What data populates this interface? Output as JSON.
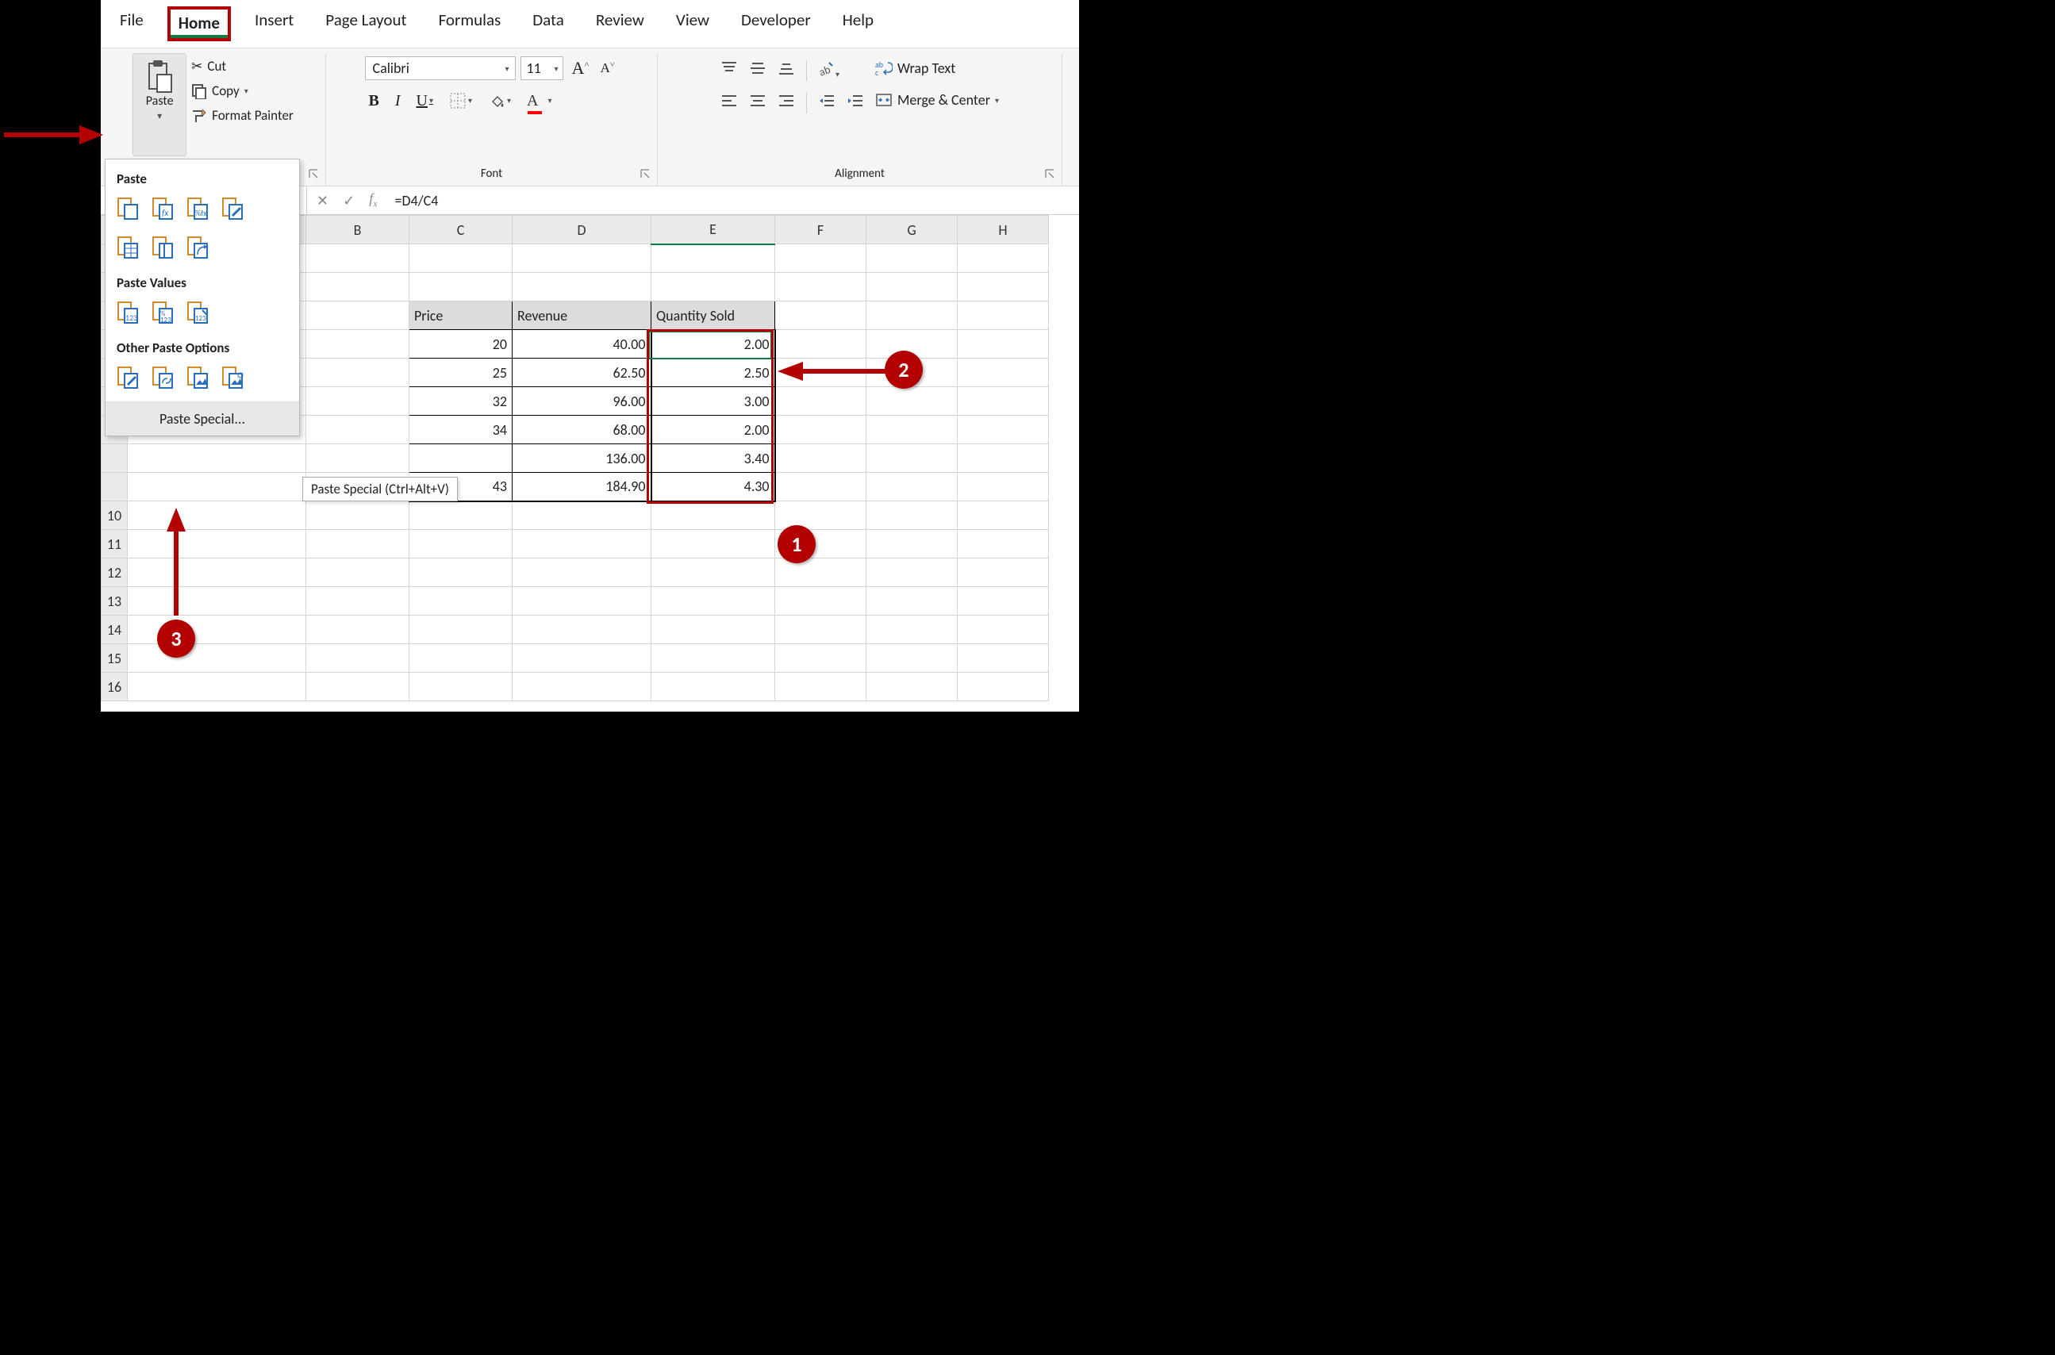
{
  "tabs": {
    "file": "File",
    "home": "Home",
    "insert": "Insert",
    "pagelayout": "Page Layout",
    "formulas": "Formulas",
    "data": "Data",
    "review": "Review",
    "view": "View",
    "developer": "Developer",
    "help": "Help"
  },
  "clipboard": {
    "paste": "Paste",
    "cut": "Cut",
    "copy": "Copy",
    "format_painter": "Format Painter"
  },
  "font": {
    "name": "Calibri",
    "size": "11",
    "group_label": "Font"
  },
  "alignment": {
    "wrap": "Wrap Text",
    "merge": "Merge & Center",
    "group_label": "Alignment"
  },
  "formula_bar": {
    "content": "=D4/C4"
  },
  "columns": {
    "b": "B",
    "c": "C",
    "d": "D",
    "e": "E",
    "f": "F",
    "g": "G",
    "h": "H"
  },
  "headers": {
    "price": "Price",
    "revenue": "Revenue",
    "qty": "Quantity Sold"
  },
  "rows": [
    {
      "price": "20",
      "rev": "40.00",
      "qty": "2.00"
    },
    {
      "price": "25",
      "rev": "62.50",
      "qty": "2.50"
    },
    {
      "price": "32",
      "rev": "96.00",
      "qty": "3.00"
    },
    {
      "price": "34",
      "rev": "68.00",
      "qty": "2.00"
    },
    {
      "price": "",
      "rev": "136.00",
      "qty": "3.40"
    },
    {
      "price": "43",
      "rev": "184.90",
      "qty": "4.30"
    }
  ],
  "row_nums": {
    "r10": "10",
    "r11": "11",
    "r12": "12",
    "r13": "13",
    "r14": "14",
    "r15": "15",
    "r16": "16"
  },
  "paste_menu": {
    "paste": "Paste",
    "paste_values": "Paste Values",
    "other": "Other Paste Options",
    "paste_special": "Paste Special..."
  },
  "tooltip": "Paste Special (Ctrl+Alt+V)",
  "annotations": {
    "a1": "1",
    "a2": "2",
    "a3": "3"
  }
}
